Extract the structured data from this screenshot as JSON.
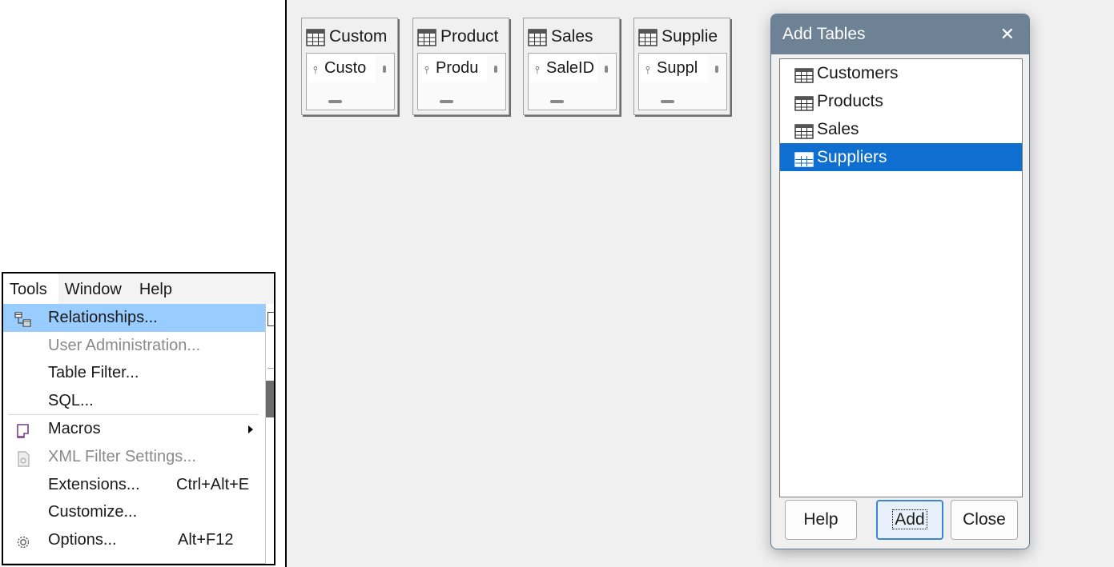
{
  "menubar": {
    "items": [
      "Tools",
      "Window",
      "Help"
    ]
  },
  "tools_menu": {
    "items": [
      {
        "label": "Relationships...",
        "icon": "relationships-icon",
        "state": "highlighted"
      },
      {
        "label": "User Administration...",
        "icon": "",
        "state": "disabled"
      },
      {
        "label": "Table Filter...",
        "icon": "",
        "state": "normal"
      },
      {
        "label": "SQL...",
        "icon": "",
        "state": "normal"
      },
      {
        "label": "Macros",
        "icon": "macros-icon",
        "state": "normal",
        "submenu": true
      },
      {
        "label": "XML Filter Settings...",
        "icon": "xml-filter-icon",
        "state": "disabled"
      },
      {
        "label": "Extensions...",
        "icon": "",
        "state": "normal",
        "shortcut": "Ctrl+Alt+E"
      },
      {
        "label": "Customize...",
        "icon": "",
        "state": "normal"
      },
      {
        "label": "Options...",
        "icon": "options-gear-icon",
        "state": "normal",
        "shortcut": "Alt+F12"
      }
    ]
  },
  "relationship_tables": [
    {
      "title": "Custom",
      "field": "Custo"
    },
    {
      "title": "Product",
      "field": "Produ"
    },
    {
      "title": "Sales",
      "field": "SaleID"
    },
    {
      "title": "Supplie",
      "field": "Suppl"
    }
  ],
  "add_tables_dialog": {
    "title": "Add Tables",
    "close_glyph": "✕",
    "tables": [
      "Customers",
      "Products",
      "Sales",
      "Suppliers"
    ],
    "selected_table": "Suppliers",
    "buttons": {
      "help": "Help",
      "add": "Add",
      "close": "Close"
    }
  },
  "colors": {
    "menu_highlight": "#99ccff",
    "list_selection": "#0f6fd1",
    "dialog_titlebar": "#6e8296",
    "canvas_background": "#f0f0f0"
  }
}
